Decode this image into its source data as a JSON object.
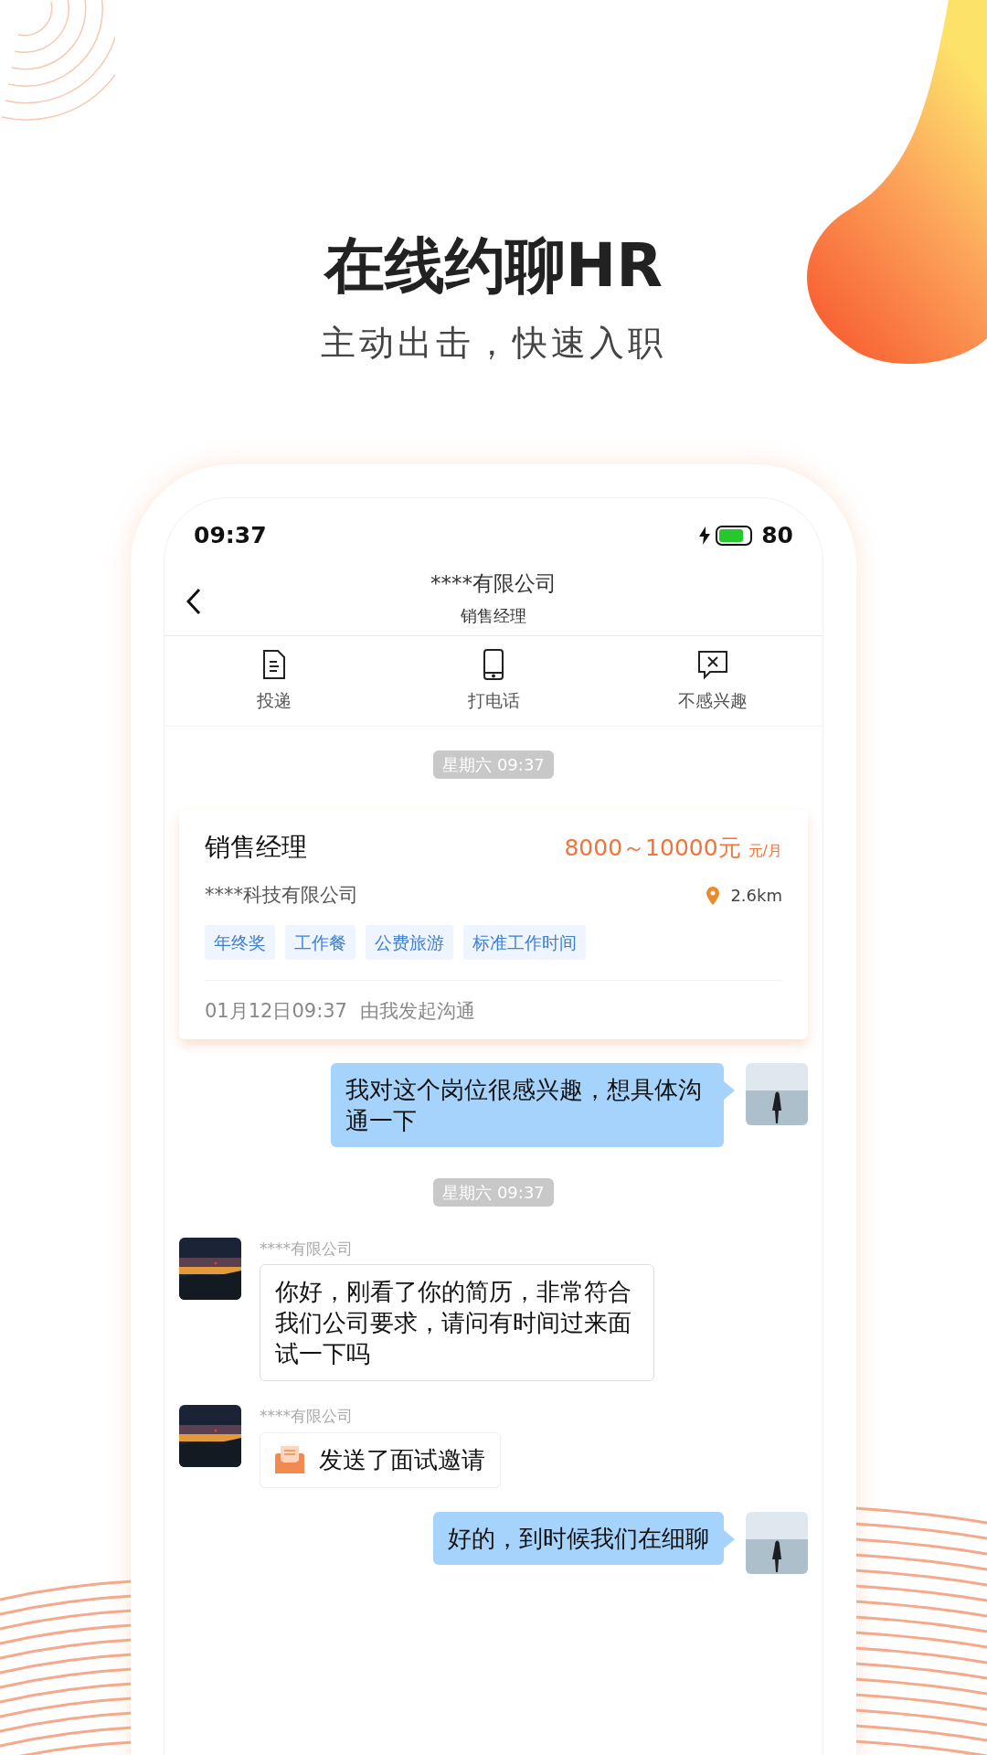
{
  "headline": "在线约聊HR",
  "subheadline": "主动出击，快速入职",
  "status_bar": {
    "time": "09:37",
    "battery": "80",
    "charging": true,
    "level": 0.8
  },
  "header": {
    "title": "****有限公司",
    "subtitle": "销售经理"
  },
  "actions": [
    {
      "label": "投递",
      "kind": "document"
    },
    {
      "label": "打电话",
      "kind": "phone"
    },
    {
      "label": "不感兴趣",
      "kind": "dismiss"
    }
  ],
  "messages": [
    {
      "kind": "time",
      "text": "星期六 09:37"
    },
    {
      "kind": "card",
      "title": "销售经理",
      "salary": "8000～10000元",
      "unit": "元/月",
      "company": "****科技有限公司",
      "distance": "2.6km",
      "tags": [
        "年终奖",
        "工作餐",
        "公费旅游",
        "标准工作时间"
      ],
      "footer_date": "01月12日09:37",
      "footer_note": "由我发起沟通"
    },
    {
      "kind": "sent",
      "text": "我对这个岗位很感兴趣，想具体沟通一下"
    },
    {
      "kind": "time",
      "text": "星期六 09:37"
    },
    {
      "kind": "received",
      "sender": "****有限公司",
      "text": "你好，刚看了你的简历，非常符合我们公司要求，请问有时间过来面试一下吗"
    },
    {
      "kind": "invite",
      "sender": "****有限公司",
      "text": "发送了面试邀请"
    },
    {
      "kind": "sent",
      "text": "好的，到时候我们在细聊"
    }
  ]
}
